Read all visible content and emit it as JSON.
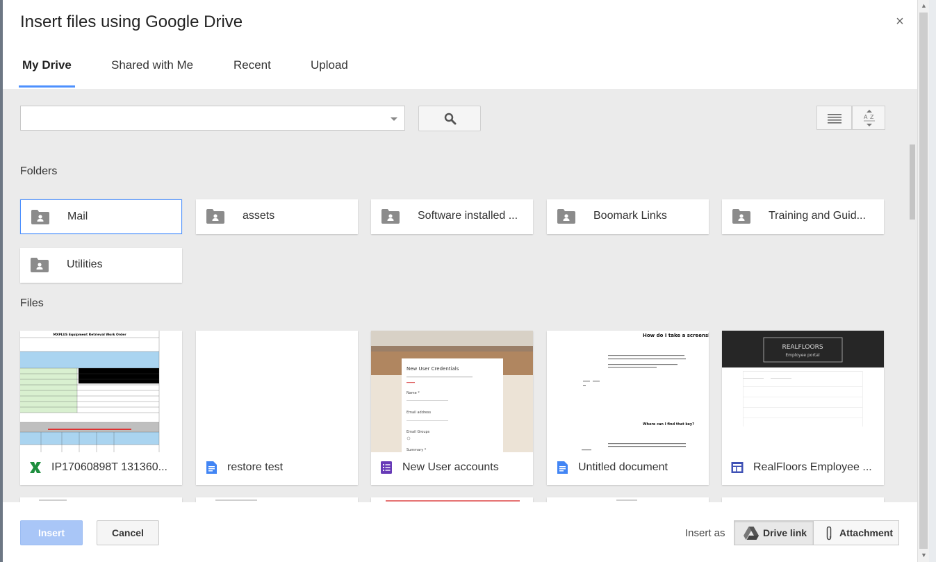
{
  "dialog": {
    "title": "Insert files using Google Drive",
    "close_glyph": "×"
  },
  "tabs": [
    {
      "label": "My Drive",
      "active": true
    },
    {
      "label": "Shared with Me",
      "active": false
    },
    {
      "label": "Recent",
      "active": false
    },
    {
      "label": "Upload",
      "active": false
    }
  ],
  "search": {
    "value": "",
    "placeholder": ""
  },
  "sections": {
    "folders_label": "Folders",
    "files_label": "Files"
  },
  "folders": [
    {
      "name": "Mail",
      "selected": true
    },
    {
      "name": "assets",
      "selected": false
    },
    {
      "name": "Software installed ...",
      "selected": false
    },
    {
      "name": "Boomark Links",
      "selected": false
    },
    {
      "name": "Training and Guid...",
      "selected": false
    },
    {
      "name": "Utilities",
      "selected": false
    }
  ],
  "files": [
    {
      "name": "IP17060898T 131360...",
      "type": "sheet",
      "icon": "excel-icon"
    },
    {
      "name": "restore test",
      "type": "doc",
      "icon": "docs-icon"
    },
    {
      "name": "New User accounts",
      "type": "form",
      "icon": "forms-icon"
    },
    {
      "name": "Untitled document",
      "type": "doc",
      "icon": "docs-icon"
    },
    {
      "name": "RealFloors Employee ...",
      "type": "site",
      "icon": "sites-icon"
    }
  ],
  "thumbnails": {
    "sheet_header": "MXPLUS Equipment Retrieval Work Order",
    "form_title": "New User Credentials",
    "form_fields": [
      "Name *",
      "Email address",
      "Email Groups",
      "Summary *"
    ],
    "doc_heading": "How do I take a screenshot?",
    "doc_subheading": "Where can I find that key?",
    "site_brand": "REALFLOORS",
    "site_sub": "Employee portal"
  },
  "footer": {
    "insert_label": "Insert",
    "cancel_label": "Cancel",
    "insert_as_label": "Insert as",
    "drive_link_label": "Drive link",
    "attachment_label": "Attachment",
    "selected_mode": "Drive link"
  },
  "colors": {
    "accent": "#4d90fe",
    "insert_disabled": "#a9c6f7",
    "excel_green": "#1e8e3e",
    "docs_blue": "#4285f4",
    "forms_purple": "#673ab7",
    "sites_indigo": "#3f51b5"
  }
}
